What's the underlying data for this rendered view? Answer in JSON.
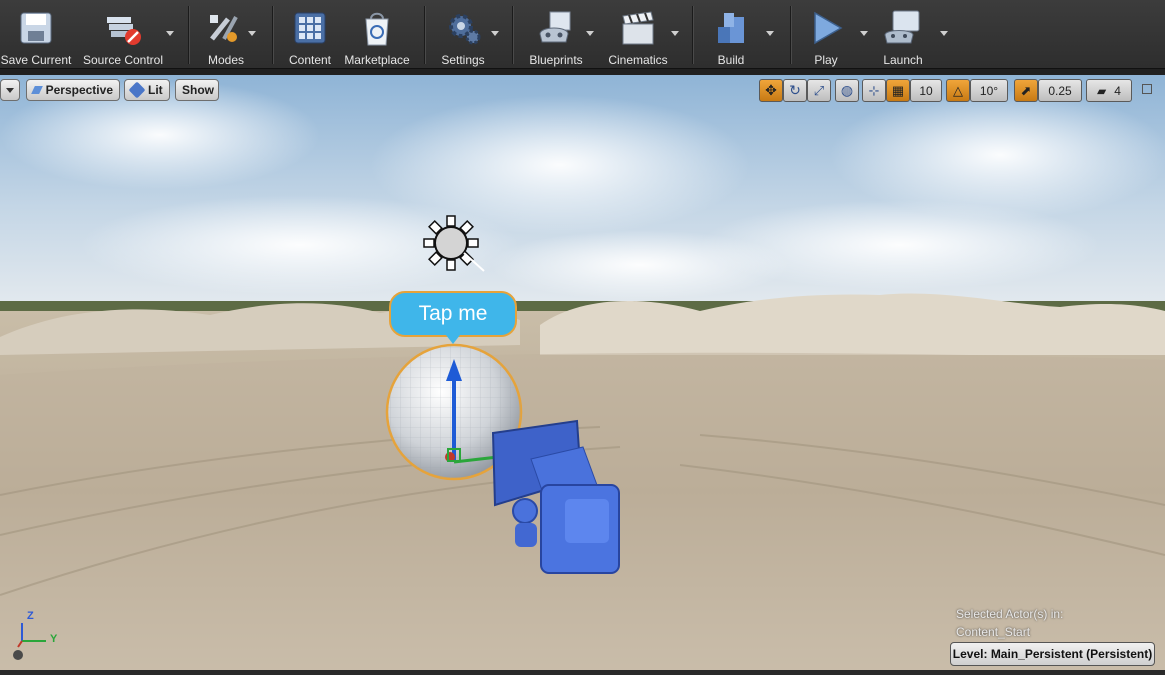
{
  "toolbar": {
    "save_current": "Save Current",
    "source_control": "Source Control",
    "modes": "Modes",
    "content": "Content",
    "marketplace": "Marketplace",
    "settings": "Settings",
    "blueprints": "Blueprints",
    "cinematics": "Cinematics",
    "build": "Build",
    "play": "Play",
    "launch": "Launch"
  },
  "viewport": {
    "perspective_label": "Perspective",
    "lit_label": "Lit",
    "show_label": "Show",
    "grid_snap_value": "10",
    "rotation_snap_value": "10°",
    "scale_snap_value": "0.25",
    "camera_speed_value": "4",
    "tap_label": "Tap me",
    "selected_actors_line1": "Selected Actor(s) in:",
    "selected_actors_line2": "Content_Start",
    "level_label": "Level:  Main_Persistent (Persistent)",
    "axis_z": "Z",
    "axis_y": "Y"
  },
  "colors": {
    "accent_orange": "#e6a33a",
    "bubble_blue": "#3fb6ea",
    "toolbar_bg": "#353535"
  }
}
